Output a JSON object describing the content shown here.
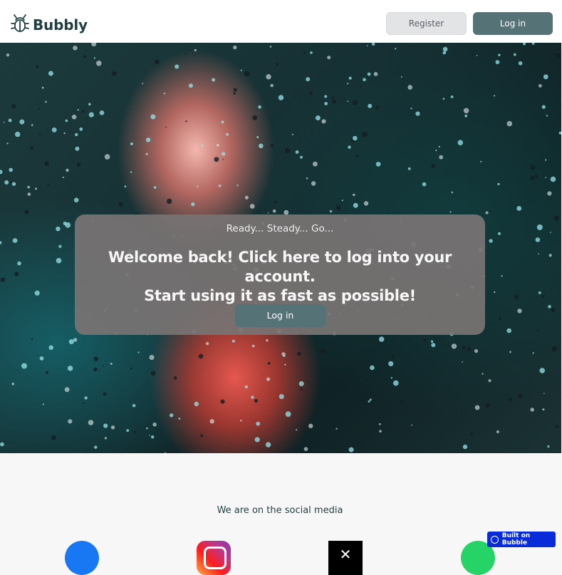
{
  "header": {
    "brand": "Bubbly",
    "register_label": "Register",
    "login_label": "Log in"
  },
  "hero": {
    "eyebrow": "Ready... Steady... Go...",
    "heading_line1": "Welcome back! Click here to log into your account.",
    "heading_line2": "Start using it as fast as possible!",
    "cta_label": "Log in"
  },
  "social": {
    "title": "We are on the social media",
    "icons": [
      "facebook-icon",
      "instagram-icon",
      "x-icon",
      "whatsapp-icon"
    ]
  },
  "badge": {
    "label": "Built on Bubble"
  },
  "colors": {
    "brand": "#1f3f43",
    "primary_button": "#557277",
    "register_button": "#e3e4e6",
    "badge": "#0a2bd8"
  }
}
